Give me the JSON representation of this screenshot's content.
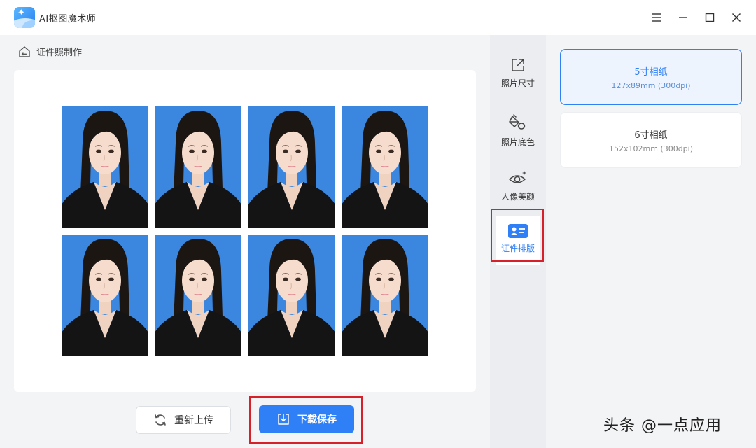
{
  "app": {
    "title": "AI抠图魔术师",
    "accent_color": "#2f7ff6",
    "highlight_color": "#d8202a",
    "photo_background_color": "#3b87e0"
  },
  "window_controls": {
    "menu_icon": "hamburger-icon",
    "minimize_icon": "minimize-icon",
    "maximize_icon": "maximize-icon",
    "close_icon": "close-icon"
  },
  "breadcrumb": {
    "icon": "home-back-icon",
    "label": "证件照制作"
  },
  "preview": {
    "layout": "2 rows x 4 columns",
    "photos_count": 8
  },
  "actions": {
    "reupload_label": "重新上传",
    "reupload_icon": "refresh-icon",
    "save_label": "下载保存",
    "save_icon": "download-icon"
  },
  "tools": [
    {
      "label": "照片尺寸",
      "icon": "resize-icon",
      "active": false
    },
    {
      "label": "照片底色",
      "icon": "paint-bucket-icon",
      "active": false
    },
    {
      "label": "人像美颜",
      "icon": "eye-sparkle-icon",
      "active": false
    },
    {
      "label": "证件排版",
      "icon": "id-card-icon",
      "active": true
    }
  ],
  "paper_options": [
    {
      "name": "5寸相纸",
      "spec": "127x89mm  (300dpi)",
      "selected": true
    },
    {
      "name": "6寸相纸",
      "spec": "152x102mm  (300dpi)",
      "selected": false
    }
  ],
  "watermark": "头条 @一点应用"
}
